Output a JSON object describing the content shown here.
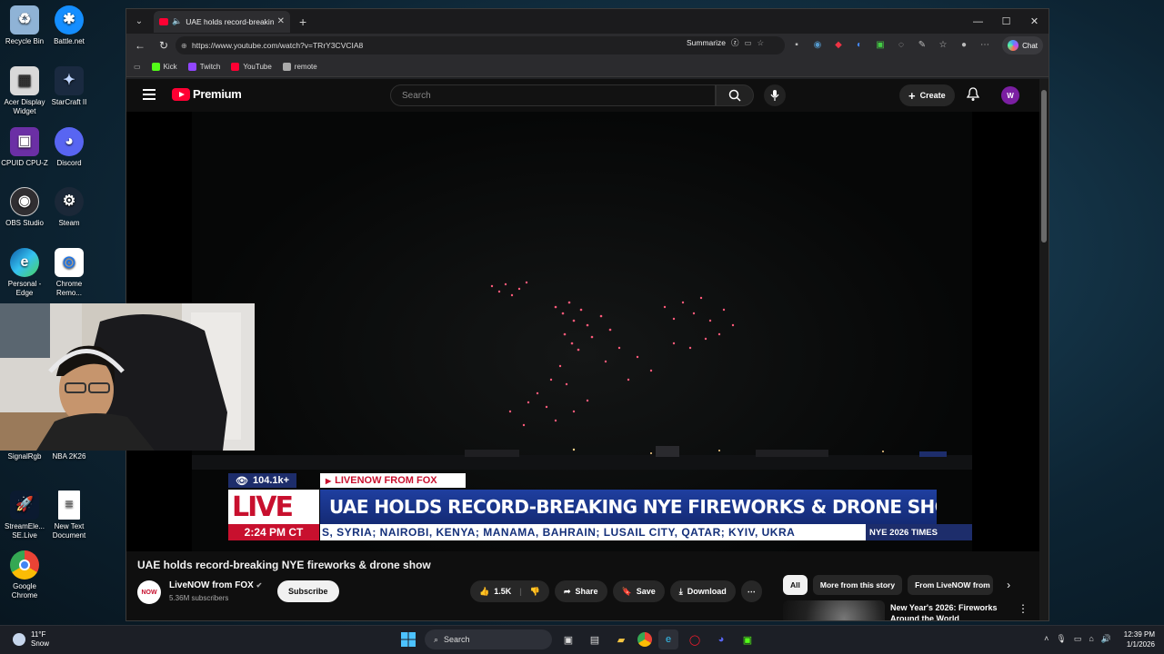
{
  "desktop": {
    "icons": [
      {
        "label": "Recycle Bin",
        "icon": "recycle-bin-icon"
      },
      {
        "label": "Battle.net",
        "icon": "battlenet-icon"
      },
      {
        "label": "Acer Display Widget",
        "icon": "acer-display-widget-icon"
      },
      {
        "label": "StarCraft II",
        "icon": "starcraft-icon"
      },
      {
        "label": "CPUID CPU-Z",
        "icon": "cpuz-icon"
      },
      {
        "label": "Discord",
        "icon": "discord-icon"
      },
      {
        "label": "OBS Studio",
        "icon": "obs-icon"
      },
      {
        "label": "Steam",
        "icon": "steam-icon"
      },
      {
        "label": "Personal - Edge",
        "icon": "edge-icon"
      },
      {
        "label": "Chrome Remo...",
        "icon": "chrome-remote-icon"
      },
      {
        "label": "SignalRgb",
        "icon": "signalrgb-icon"
      },
      {
        "label": "NBA 2K26",
        "icon": "nba2k-icon"
      },
      {
        "label": "StreamEle... SE.Live",
        "icon": "streamelements-icon"
      },
      {
        "label": "New Text Document",
        "icon": "text-document-icon"
      },
      {
        "label": "Google Chrome",
        "icon": "chrome-icon"
      }
    ]
  },
  "browser": {
    "tab_title": "UAE holds record-breaking N",
    "url": "https://www.youtube.com/watch?v=TRrY3CVCIA8",
    "summarize_label": "Summarize",
    "chat_label": "Chat",
    "bookmarks": [
      {
        "label": "Kick",
        "color": "#53fc18"
      },
      {
        "label": "Twitch",
        "color": "#9146ff"
      },
      {
        "label": "YouTube",
        "color": "#ff0033"
      },
      {
        "label": "remote",
        "color": "#aaaaaa"
      }
    ]
  },
  "youtube": {
    "logo_text": "Premium",
    "search_placeholder": "Search",
    "create_label": "Create",
    "avatar_letter": "W",
    "overlay": {
      "viewers": "104.1k+",
      "source": "LIVENOW FROM FOX",
      "logo": "LIVE",
      "headline": "UAE HOLDS RECORD-BREAKING NYE FIREWORKS & DRONE SHOW",
      "time": "2:24 PM CT",
      "ticker": "S,  SYRIA;  NAIROBI,  KENYA;  MANAMA,  BAHRAIN;  LUSAIL CITY,  QATAR;  KYIV,  UKRA",
      "tag": "NYE 2026 TIMES"
    },
    "video_title": "UAE holds record-breaking NYE fireworks & drone show",
    "channel": {
      "avatar_text": "NOW",
      "name": "LiveNOW from FOX",
      "subscribers": "5.36M subscribers",
      "subscribe_label": "Subscribe"
    },
    "actions": {
      "likes": "1.5K",
      "share": "Share",
      "save": "Save",
      "download": "Download"
    },
    "chips": [
      "All",
      "More from this story",
      "From LiveNOW from"
    ],
    "recommendation": {
      "title": "New Year's 2026: Fireworks Around the World"
    }
  },
  "taskbar": {
    "weather_temp": "11°F",
    "weather_desc": "Snow",
    "search_label": "Search",
    "time": "12:39 PM",
    "date": "1/1/2026"
  }
}
